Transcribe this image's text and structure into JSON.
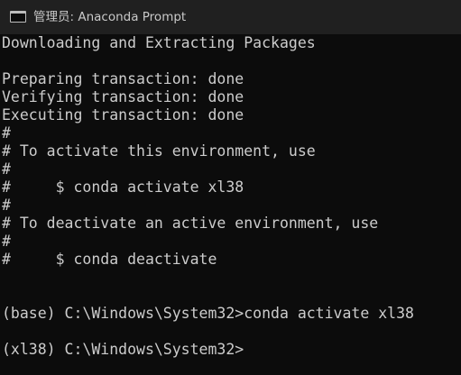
{
  "window": {
    "title": "管理员: Anaconda Prompt"
  },
  "terminal": {
    "lines": [
      "Downloading and Extracting Packages",
      "",
      "Preparing transaction: done",
      "Verifying transaction: done",
      "Executing transaction: done",
      "#",
      "# To activate this environment, use",
      "#",
      "#     $ conda activate xl38",
      "#",
      "# To deactivate an active environment, use",
      "#",
      "#     $ conda deactivate",
      "",
      "",
      "(base) C:\\Windows\\System32>conda activate xl38",
      "",
      "(xl38) C:\\Windows\\System32>"
    ]
  }
}
